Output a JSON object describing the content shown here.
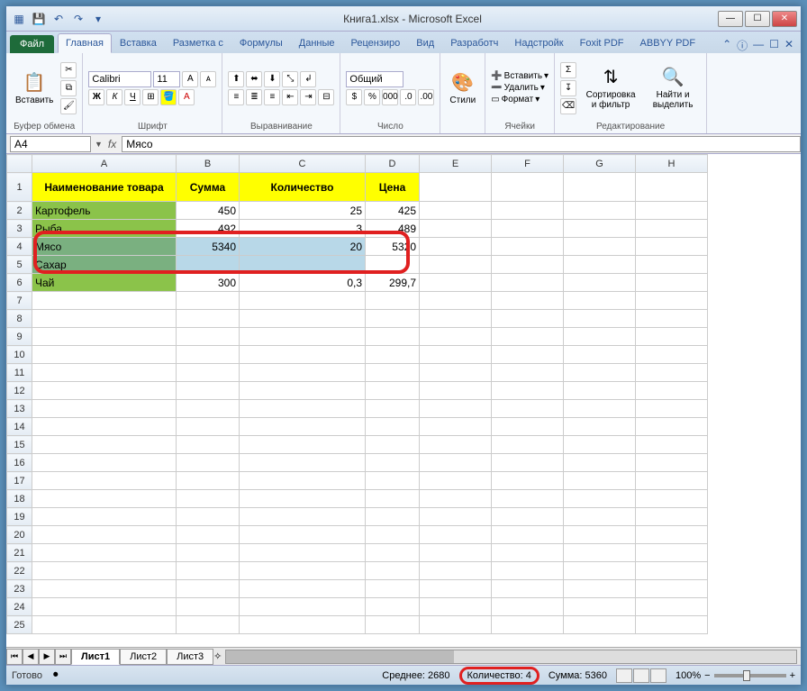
{
  "title": "Книга1.xlsx - Microsoft Excel",
  "tabs": {
    "file": "Файл",
    "home": "Главная",
    "insert": "Вставка",
    "layout": "Разметка с",
    "formulas": "Формулы",
    "data": "Данные",
    "review": "Рецензиро",
    "view": "Вид",
    "developer": "Разработч",
    "addins": "Надстройк",
    "foxit": "Foxit PDF",
    "abbyy": "ABBYY PDF"
  },
  "ribbon": {
    "clipboard": {
      "paste": "Вставить",
      "label": "Буфер обмена"
    },
    "font": {
      "name": "Calibri",
      "size": "11",
      "label": "Шрифт"
    },
    "align": {
      "label": "Выравнивание"
    },
    "number": {
      "format": "Общий",
      "label": "Число"
    },
    "styles": {
      "btn": "Стили"
    },
    "cells": {
      "insert": "Вставить",
      "delete": "Удалить",
      "format": "Формат",
      "label": "Ячейки"
    },
    "editing": {
      "sort": "Сортировка и фильтр",
      "find": "Найти и выделить",
      "label": "Редактирование"
    }
  },
  "namebox": "A4",
  "formula": "Мясо",
  "columns": [
    "A",
    "B",
    "C",
    "D",
    "E",
    "F",
    "G",
    "H"
  ],
  "headers": {
    "name": "Наименование товара",
    "sum": "Сумма",
    "qty": "Количество",
    "price": "Цена"
  },
  "rows": [
    {
      "name": "Картофель",
      "sum": "450",
      "qty": "25",
      "price": "425"
    },
    {
      "name": "Рыба",
      "sum": "492",
      "qty": "3",
      "price": "489"
    },
    {
      "name": "Мясо",
      "sum": "5340",
      "qty": "20",
      "price": "5320"
    },
    {
      "name": "Сахар",
      "sum": "",
      "qty": "",
      "price": ""
    },
    {
      "name": "Чай",
      "sum": "300",
      "qty": "0,3",
      "price": "299,7"
    }
  ],
  "sheets": {
    "s1": "Лист1",
    "s2": "Лист2",
    "s3": "Лист3"
  },
  "status": {
    "ready": "Готово",
    "avg": "Среднее: 2680",
    "count": "Количество: 4",
    "sum": "Сумма: 5360",
    "zoom": "100%"
  }
}
